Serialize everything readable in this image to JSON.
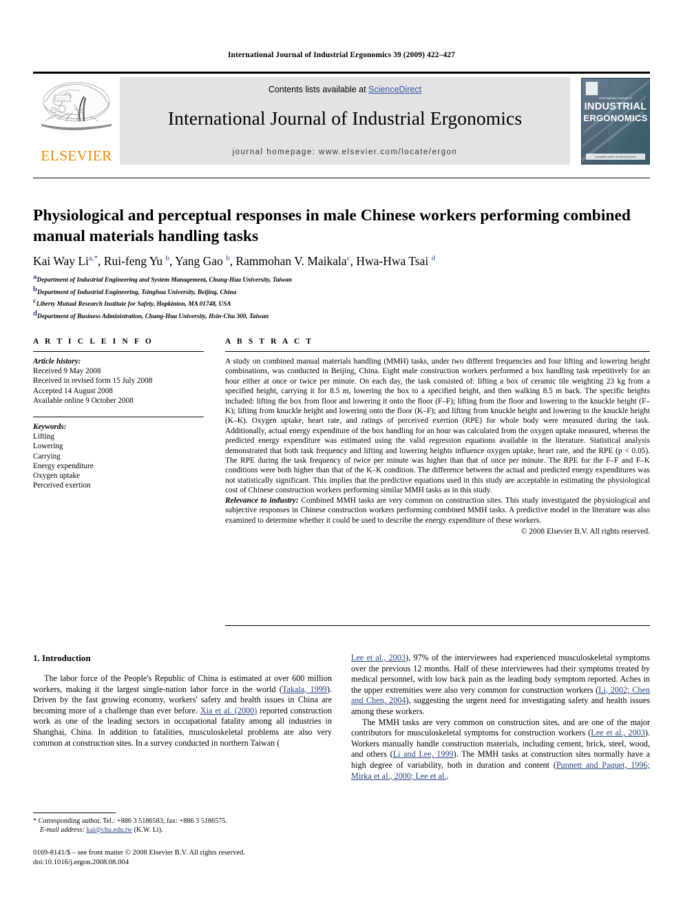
{
  "running_head": "International Journal of Industrial Ergonomics 39 (2009) 422–427",
  "masthead": {
    "contents_prefix": "Contents lists available at ",
    "sciencedirect": "ScienceDirect",
    "journal_title": "International Journal of Industrial Ergonomics",
    "homepage": "journal homepage: www.elsevier.com/locate/ergon",
    "elsevier_wordmark": "ELSEVIER",
    "elsevier_orange": "#ED8B00",
    "link_blue": "#3a57a8",
    "cover": {
      "supertitle": "International Journal of",
      "line1": "INDUSTRIAL",
      "line2": "ERGONOMICS",
      "footer": "Available online at ScienceDirect"
    }
  },
  "article": {
    "title": "Physiological and perceptual responses in male Chinese workers performing combined manual materials handling tasks",
    "authors": [
      {
        "name": "Kai Way Li",
        "sup": "a,*"
      },
      {
        "name": "Rui-feng Yu",
        "sup": "b"
      },
      {
        "name": "Yang Gao",
        "sup": "b"
      },
      {
        "name": "Rammohan V. Maikala",
        "sup": "c"
      },
      {
        "name": "Hwa-Hwa Tsai",
        "sup": "d"
      }
    ],
    "affiliations": [
      {
        "sup": "a",
        "text": "Department of Industrial Engineering and System Management, Chung-Hua University, Taiwan"
      },
      {
        "sup": "b",
        "text": "Department of Industrial Engineering, Tsinghua University, Beijing, China"
      },
      {
        "sup": "c",
        "text": "Liberty Mutual Research Institute for Safety, Hopkinton, MA 01748, USA"
      },
      {
        "sup": "d",
        "text": "Department of Business Administration, Chung-Hua University, Hsin-Chu 300, Taiwan"
      }
    ]
  },
  "article_info": {
    "heading": "A R T I C L E  I N F O",
    "history_label": "Article history:",
    "history": [
      "Received 9 May 2008",
      "Received in revised form 15 July 2008",
      "Accepted 14 August 2008",
      "Available online 9 October 2008"
    ],
    "keywords_label": "Keywords:",
    "keywords": [
      "Lifting",
      "Lowering",
      "Carrying",
      "Energy expenditure",
      "Oxygen uptake",
      "Perceived exertion"
    ]
  },
  "abstract": {
    "heading": "A B S T R A C T",
    "text": "A study on combined manual materials handling (MMH) tasks, under two different frequencies and four lifting and lowering height combinations, was conducted in Beijing, China. Eight male construction workers performed a box handling task repetitively for an hour either at once or twice per minute. On each day, the task consisted of: lifting a box of ceramic tile weighting 23 kg from a specified height, carrying it for 8.5 m, lowering the box to a specified height, and then walking 8.5 m back. The specific heights included: lifting the box from floor and lowering it onto the floor (F–F); lifting from the floor and lowering to the knuckle height (F–K); lifting from knuckle height and lowering onto the floor (K–F); and lifting from knuckle height and lowering to the knuckle height (K–K). Oxygen uptake, heart rate, and ratings of perceived exertion (RPE) for whole body were measured during the task. Additionally, actual energy expenditure of the box handling for an hour was calculated from the oxygen uptake measured, whereas the predicted energy expenditure was estimated using the valid regression equations available in the literature. Statistical analysis demonstrated that both task frequency and lifting and lowering heights influence oxygen uptake, heart rate, and the RPE (p < 0.05). The RPE during the task frequency of twice per minute was higher than that of once per minute. The RPE for the F–F and F–K conditions were both higher than that of the K–K condition. The difference between the actual and predicted energy expenditures was not statistically significant. This implies that the predictive equations used in this study are acceptable in estimating the physiological cost of Chinese construction workers performing similar MMH tasks as in this study.",
    "relevance_label": "Relevance to industry:",
    "relevance_text": " Combined MMH tasks are very common on construction sites. This study investigated the physiological and subjective responses in Chinese construction workers performing combined MMH tasks. A predictive model in the literature was also examined to determine whether it could be used to describe the energy expenditure of these workers.",
    "copyright": "© 2008 Elsevier B.V. All rights reserved."
  },
  "introduction": {
    "heading": "1. Introduction",
    "left_p1_a": "The labor force of the People's Republic of China is estimated at over 600 million workers, making it the largest single-nation labor force in the world (",
    "left_cite1": "Takala, 1999",
    "left_p1_b": "). Driven by the fast growing economy, workers' safety and health issues in China are becoming more of a challenge than ever before. ",
    "left_cite2": "Xia et al. (2000)",
    "left_p1_c": " reported construction work as one of the leading sectors in occupational fatality among all industries in Shanghai, China. In addition to fatalities, musculoskeletal problems are also very common at construction sites. In a survey conducted in northern Taiwan (",
    "right_cite1": "Lee et al., 2003",
    "right_p1_a": "), 97% of the interviewees had experienced musculoskeletal symptoms over the previous 12 months. Half of these interviewees had their symptoms treated by medical personnel, with low back pain as the leading body symptom reported. Aches in the upper extremities were also very common for construction workers (",
    "right_cite2": "Li, 2002; Chen and Chen, 2004",
    "right_p1_b": "), suggesting the urgent need for investigating safety and health issues among these workers.",
    "right_p2_a": "The MMH tasks are very common on construction sites, and are one of the major contributors for musculoskeletal symptoms for construction workers (",
    "right_cite3": "Lee et al., 2003",
    "right_p2_b": "). Workers manually handle construction materials, including cement, brick, steel, wood, and others (",
    "right_cite4": "Li and Lee, 1999",
    "right_p2_c": "). The MMH tasks at construction sites normally have a high degree of variability, both in duration and content (",
    "right_cite5": "Punnett and Paquet, 1996; Mirka et al., 2000; Lee et al.,"
  },
  "footnotes": {
    "corresponding": "* Corresponding author. Tel.: +886 3 5186583; fax: +886 3 5186575.",
    "email_label": "E-mail address:",
    "email": "kai@chu.edu.tw",
    "email_suffix": " (K.W. Li).",
    "issn_line": "0169-8141/$ – see front matter © 2008 Elsevier B.V. All rights reserved.",
    "doi_line": "doi:10.1016/j.ergon.2008.08.004"
  }
}
